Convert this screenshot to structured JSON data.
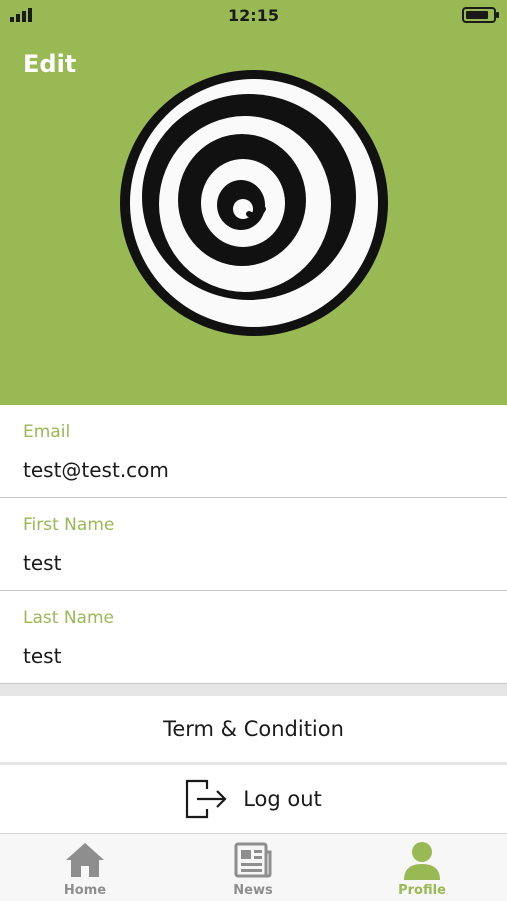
{
  "status_bar": {
    "time": "12:15"
  },
  "header": {
    "edit_label": "Edit"
  },
  "form": {
    "fields": [
      {
        "label": "Email",
        "value": "test@test.com"
      },
      {
        "label": "First Name",
        "value": "test"
      },
      {
        "label": "Last Name",
        "value": "test"
      }
    ]
  },
  "actions": {
    "terms_label": "Term & Condition",
    "logout_label": "Log out"
  },
  "tab_bar": {
    "tabs": [
      {
        "label": "Home",
        "icon": "home-icon",
        "active": false
      },
      {
        "label": "News",
        "icon": "news-icon",
        "active": false
      },
      {
        "label": "Profile",
        "icon": "profile-icon",
        "active": true
      }
    ]
  },
  "colors": {
    "accent": "#98b954",
    "tab_inactive": "#8e8e8e",
    "text": "#1a1a1a"
  }
}
